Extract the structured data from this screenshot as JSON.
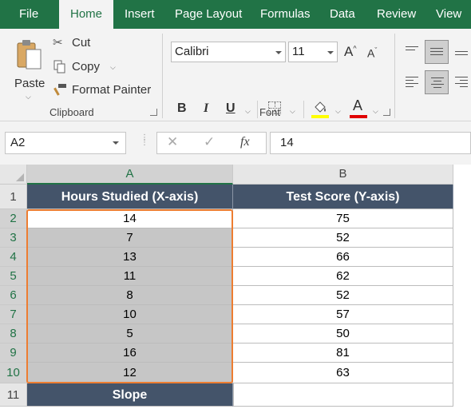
{
  "tabs": [
    "File",
    "Home",
    "Insert",
    "Page Layout",
    "Formulas",
    "Data",
    "Review",
    "View"
  ],
  "active_tab": "Home",
  "clipboard": {
    "paste_label": "Paste",
    "cut_label": "Cut",
    "copy_label": "Copy",
    "format_painter_label": "Format Painter",
    "group_label": "Clipboard"
  },
  "font": {
    "font_name": "Calibri",
    "font_size": "11",
    "group_label": "Font",
    "bold": "B",
    "italic": "I",
    "underline": "U",
    "font_color_glyph": "A",
    "highlight_color": "#ffff00",
    "font_color": "#e00000"
  },
  "formula_bar": {
    "name_box": "A2",
    "fx_label": "fx",
    "cancel_glyph": "✕",
    "enter_glyph": "✓",
    "formula": "14"
  },
  "sheet": {
    "columns": [
      "A",
      "B"
    ],
    "rows": [
      "1",
      "2",
      "3",
      "4",
      "5",
      "6",
      "7",
      "8",
      "9",
      "10",
      "11"
    ],
    "header": {
      "a": "Hours Studied (X-axis)",
      "b": "Test Score (Y-axis)"
    },
    "data": [
      {
        "x": "14",
        "y": "75"
      },
      {
        "x": "7",
        "y": "52"
      },
      {
        "x": "13",
        "y": "66"
      },
      {
        "x": "11",
        "y": "62"
      },
      {
        "x": "8",
        "y": "52"
      },
      {
        "x": "10",
        "y": "57"
      },
      {
        "x": "5",
        "y": "50"
      },
      {
        "x": "16",
        "y": "81"
      },
      {
        "x": "12",
        "y": "63"
      }
    ],
    "slope_label": "Slope",
    "slope_value": ""
  },
  "colors": {
    "brand": "#217346",
    "header_fill": "#44546a",
    "selection_border": "#ed7d31"
  }
}
